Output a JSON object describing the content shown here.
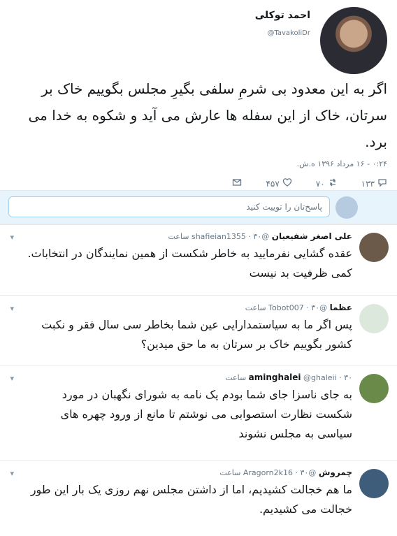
{
  "tweet": {
    "name": "احمد توکلی",
    "handle": "@TavakoliDr",
    "text": "اگر به این معدود بی شرمِ سلفی بگیرِ مجلس بگوییم خاک بر سرتان، خاک از این سفله ها عارش می آید و شکوه به خدا می برد.",
    "timestamp": "۰:۲۴ - ۱۶ مرداد ۱۳۹۶ ه.ش.",
    "replies_count": "۱۳۳",
    "retweets_count": "۷۰",
    "likes_count": "۴۵۷"
  },
  "reply_box": {
    "placeholder": "پاسخ‌تان را توییت کنید"
  },
  "replies": [
    {
      "name": "علی اصغر شفیعیان",
      "handle": "@shafieian1355",
      "time": "۳۰ ساعت",
      "text": "عقده گشایی نفرمایید به خاطر شکست از همین نمایندگان در انتخابات. کمی ظرفیت بد نیست"
    },
    {
      "name": "عظما",
      "handle": "@Tobot007",
      "time": "۳۰ ساعت",
      "text": "پس اگر ما به سیاستمدارایی عین شما بخاطر سی سال فقر و نکبت کشور بگوییم خاک بر سرتان به ما حق میدین؟"
    },
    {
      "name": "aminghalei",
      "handle": "@ghaleii",
      "time": "۳۰ ساعت",
      "text": "به جای ناسزا جای شما بودم یک نامه به شورای نگهبان در مورد شکست نظارت استصوابی می نوشتم تا مانع از ورود چهره های سیاسی به مجلس نشوند"
    },
    {
      "name": "چمروش",
      "handle": "@Aragorn2k16",
      "time": "۳۰ ساعت",
      "text": "ما هم خجالت کشیدیم، اما از داشتن مجلس نهم روزی یک بار این طور خجالت می کشیدیم."
    }
  ],
  "icons": {
    "reply": "reply-icon",
    "retweet": "retweet-icon",
    "like": "heart-icon",
    "message": "envelope-icon",
    "more": "chevron-down-icon"
  },
  "colors": {
    "accent": "#1da1f2",
    "muted": "#657786",
    "reply_bg": "#e8f4fb"
  }
}
